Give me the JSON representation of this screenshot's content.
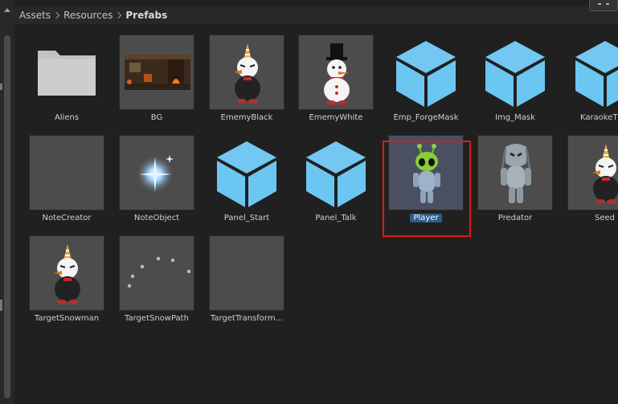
{
  "breadcrumb": [
    "Assets",
    "Resources",
    "Prefabs"
  ],
  "assets": [
    {
      "name": "Aliens",
      "icon": "folder-icon"
    },
    {
      "name": "BG",
      "icon": "bg-room-thumbnail"
    },
    {
      "name": "EmemyBlack",
      "icon": "snowman-black-icon"
    },
    {
      "name": "EmemyWhite",
      "icon": "snowman-white-icon"
    },
    {
      "name": "Emp_ForgeMask",
      "icon": "prefab-cube-icon"
    },
    {
      "name": "Img_Mask",
      "icon": "prefab-cube-icon"
    },
    {
      "name": "KaraokeT",
      "icon": "prefab-cube-icon"
    },
    {
      "name": "NoteCreator",
      "icon": "empty-thumbnail"
    },
    {
      "name": "NoteObject",
      "icon": "sparkle-icon"
    },
    {
      "name": "Panel_Start",
      "icon": "prefab-cube-icon"
    },
    {
      "name": "Panel_Talk",
      "icon": "prefab-cube-icon"
    },
    {
      "name": "Player",
      "icon": "alien-green-icon",
      "selected": true
    },
    {
      "name": "Predator",
      "icon": "predator-icon"
    },
    {
      "name": "Seed",
      "icon": "snowman-black-icon"
    },
    {
      "name": "TargetSnowman",
      "icon": "snowman-black-icon"
    },
    {
      "name": "TargetSnowPath",
      "icon": "dots-path-icon"
    },
    {
      "name": "TargetTransform...",
      "icon": "empty-thumbnail"
    }
  ],
  "colors": {
    "background": "#202020",
    "thumb_frame": "#4c4c4c",
    "cube": "#6cc6f2",
    "selection_label": "#2c5d87",
    "highlight_box": "#e01a1a"
  }
}
